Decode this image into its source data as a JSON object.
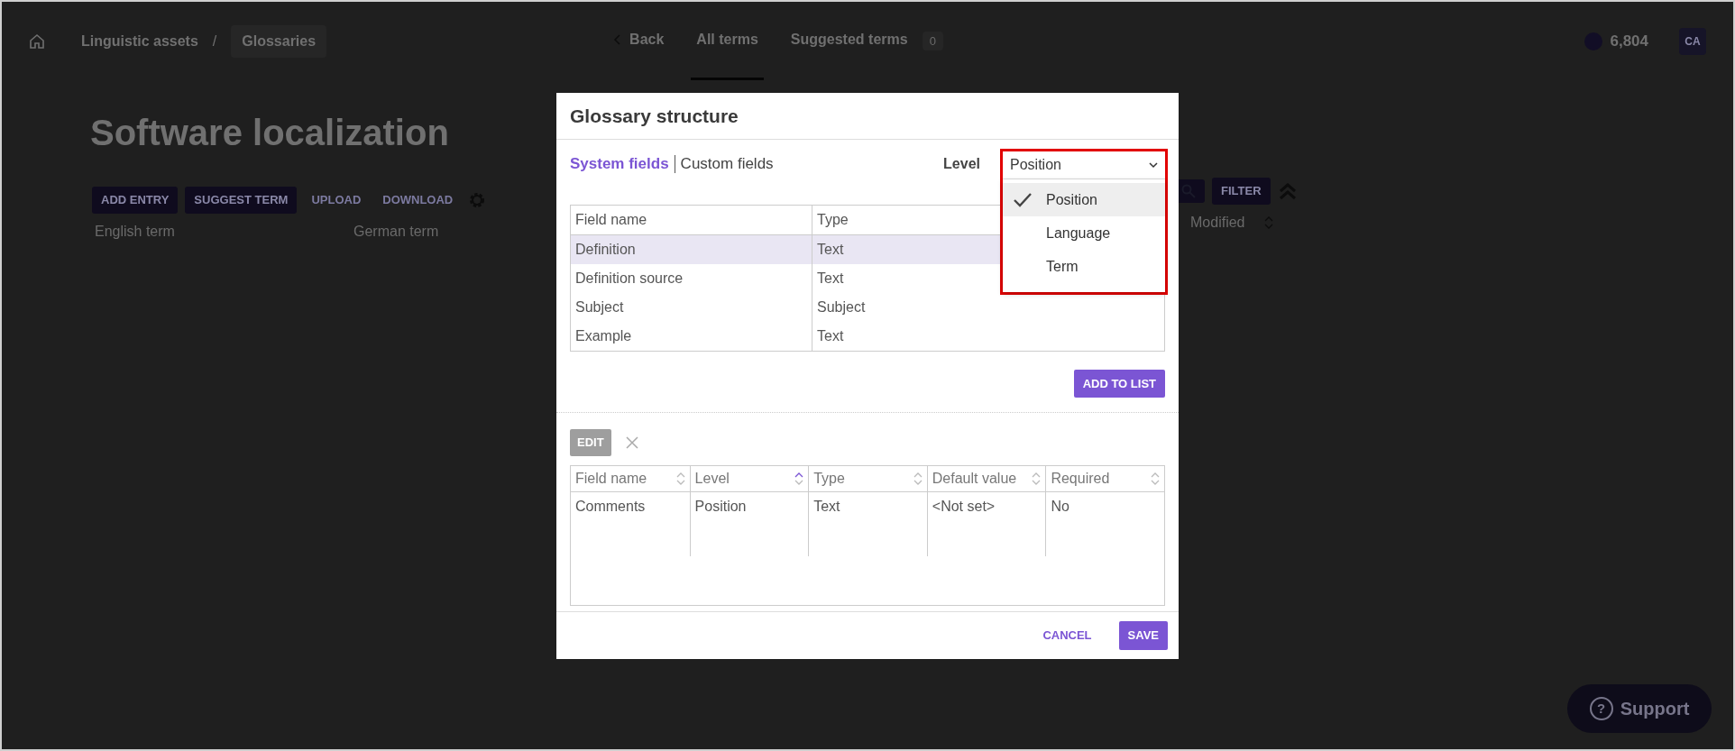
{
  "header": {
    "breadcrumbs": [
      "Linguistic assets",
      "Glossaries"
    ],
    "breadcrumb_separator": "/",
    "nav": [
      {
        "label": "Back",
        "kind": "back",
        "selected": false
      },
      {
        "label": "All terms",
        "kind": "tab",
        "selected": true
      },
      {
        "label": "Suggested terms",
        "kind": "tab",
        "selected": false,
        "count": "0"
      }
    ],
    "balance": "6,804",
    "avatar": "CA"
  },
  "page": {
    "title": "Software localization",
    "toolbar": [
      {
        "label": "ADD ENTRY",
        "kind": "filled"
      },
      {
        "label": "SUGGEST TERM",
        "kind": "filled"
      },
      {
        "label": "UPLOAD",
        "kind": "text"
      },
      {
        "label": "DOWNLOAD",
        "kind": "text"
      }
    ],
    "columns": [
      "English term",
      "German term"
    ],
    "filter": "FILTER",
    "modified_column": "Modified"
  },
  "modal": {
    "title": "Glossary structure",
    "tabs": [
      {
        "label": "System fields",
        "selected": true
      },
      {
        "label": "Custom fields",
        "selected": false
      }
    ],
    "level_label": "Level",
    "level_value": "Position",
    "level_options": [
      {
        "label": "Position",
        "selected": true
      },
      {
        "label": "Language",
        "selected": false
      },
      {
        "label": "Term",
        "selected": false
      }
    ],
    "system_table": {
      "columns": [
        "Field name",
        "Type"
      ],
      "rows": [
        {
          "cells": [
            "Definition",
            "Text"
          ],
          "selected": true
        },
        {
          "cells": [
            "Definition source",
            "Text"
          ],
          "selected": false
        },
        {
          "cells": [
            "Subject",
            "Subject"
          ],
          "selected": false
        },
        {
          "cells": [
            "Example",
            "Text"
          ],
          "selected": false
        }
      ]
    },
    "add_button": "ADD TO LIST",
    "edit_button": {
      "label": "EDIT",
      "disabled": true
    },
    "custom_table": {
      "columns": [
        {
          "label": "Field name",
          "sorted": false
        },
        {
          "label": "Level",
          "sorted": true
        },
        {
          "label": "Type",
          "sorted": false
        },
        {
          "label": "Default value",
          "sorted": false
        },
        {
          "label": "Required",
          "sorted": false
        }
      ],
      "rows": [
        [
          "Comments",
          "Position",
          "Text",
          "<Not set>",
          "No"
        ]
      ]
    },
    "buttons": [
      {
        "label": "CANCEL",
        "kind": "link"
      },
      {
        "label": "SAVE",
        "kind": "primary"
      }
    ]
  },
  "support": {
    "icon": "?",
    "label": "Support"
  }
}
